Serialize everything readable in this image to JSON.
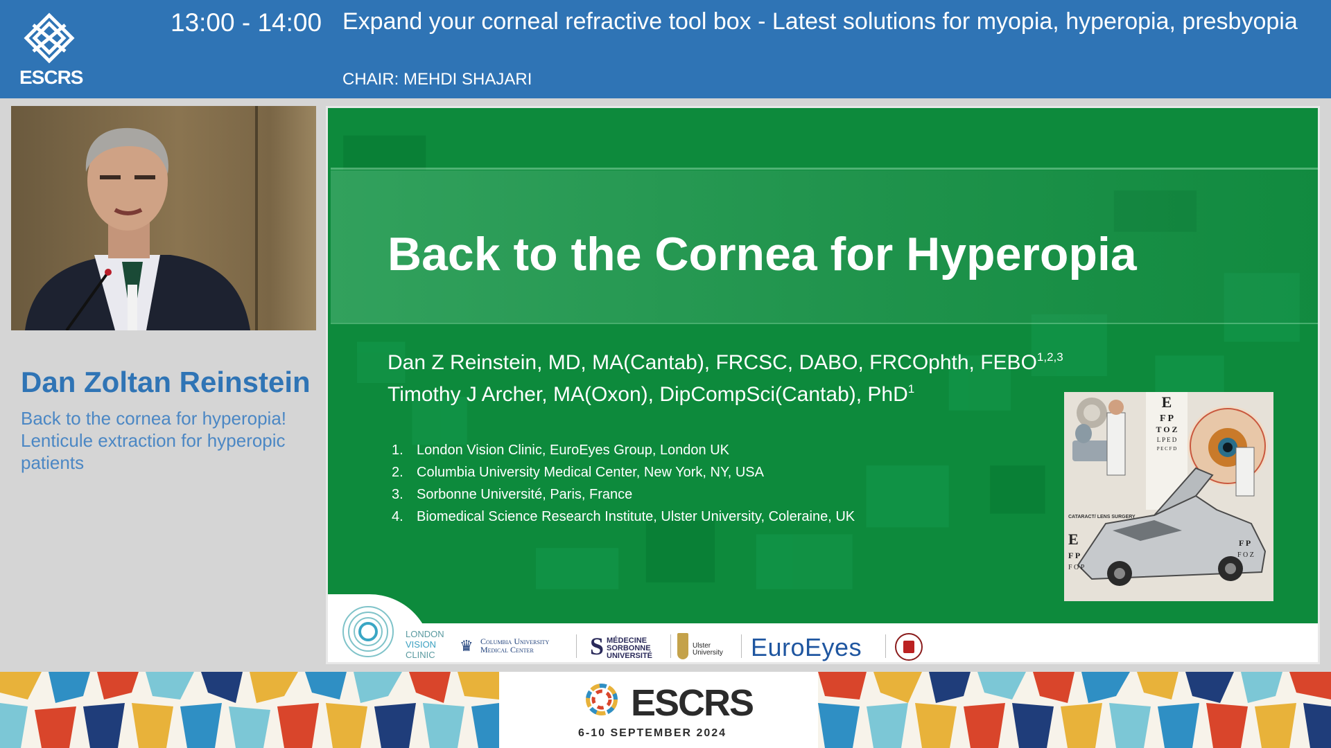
{
  "header": {
    "logo_text": "ESCRS",
    "time": "13:00 - 14:00",
    "session_title": "Expand your corneal refractive tool box - Latest solutions for myopia, hyperopia, presbyopia",
    "chair": "CHAIR: MEHDI SHAJARI"
  },
  "speaker": {
    "name": "Dan Zoltan Reinstein",
    "talk_title": "Back to the cornea for hyperopia! Lenticule extraction for hyperopic patients"
  },
  "slide": {
    "title": "Back to the Cornea for Hyperopia",
    "authors": [
      {
        "name": "Dan Z Reinstein, MD, MA(Cantab), FRCSC, DABO, FRCOphth, FEBO",
        "sup": "1,2,3"
      },
      {
        "name": "Timothy J Archer, MA(Oxon), DipCompSci(Cantab), PhD",
        "sup": "1"
      }
    ],
    "affiliations": [
      {
        "num": "1.",
        "text": "London Vision Clinic, EuroEyes Group, London UK"
      },
      {
        "num": "2.",
        "text": "Columbia University Medical Center, New York, NY, USA"
      },
      {
        "num": "3.",
        "text": "Sorbonne Université, Paris, France"
      },
      {
        "num": "4.",
        "text": "Biomedical Science Research Institute, Ulster University, Coleraine, UK"
      }
    ],
    "image_caption": "CATARACT/ LENS SURGERY",
    "logos": {
      "lvc": [
        "LONDON",
        "VISION",
        "CLINIC"
      ],
      "columbia": [
        "Columbia University",
        "Medical Center"
      ],
      "sorbonne": [
        "MÉDECINE",
        "SORBONNE",
        "UNIVERSITÉ"
      ],
      "ulster": [
        "Ulster",
        "University"
      ],
      "euroeyes": "EuroEyes"
    }
  },
  "footer": {
    "brand": "ESCRS",
    "dates": "6-10 SEPTEMBER 2024"
  },
  "colors": {
    "header_blue": "#2f74b5",
    "slide_green": "#0d8a3c",
    "name_blue": "#2f74b5"
  }
}
